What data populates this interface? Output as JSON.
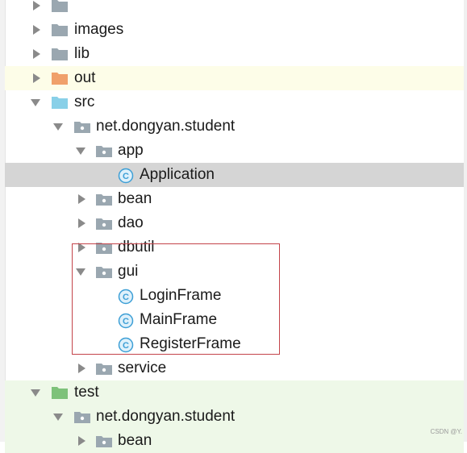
{
  "tree": {
    "rows": [
      {
        "label": "",
        "icon": "folder-icon",
        "arrow": "collapsed",
        "level": 0,
        "cut": true
      },
      {
        "label": "images",
        "icon": "folder-icon",
        "arrow": "collapsed",
        "level": 0
      },
      {
        "label": "lib",
        "icon": "folder-icon",
        "arrow": "collapsed",
        "level": 0
      },
      {
        "label": "out",
        "icon": "excluded-folder-icon",
        "arrow": "collapsed",
        "level": 0,
        "highlight": "yellow"
      },
      {
        "label": "src",
        "icon": "source-folder-icon",
        "arrow": "expanded",
        "level": 0
      },
      {
        "label": "net.dongyan.student",
        "icon": "package-icon",
        "arrow": "expanded",
        "level": 1
      },
      {
        "label": "app",
        "icon": "package-icon",
        "arrow": "expanded",
        "level": 2
      },
      {
        "label": "Application",
        "icon": "class-icon",
        "arrow": "none",
        "level": 3,
        "selected": true
      },
      {
        "label": "bean",
        "icon": "package-icon",
        "arrow": "collapsed",
        "level": 2
      },
      {
        "label": "dao",
        "icon": "package-icon",
        "arrow": "collapsed",
        "level": 2
      },
      {
        "label": "dbutil",
        "icon": "package-icon",
        "arrow": "collapsed",
        "level": 2
      },
      {
        "label": "gui",
        "icon": "package-icon",
        "arrow": "expanded",
        "level": 2
      },
      {
        "label": "LoginFrame",
        "icon": "class-icon",
        "arrow": "none",
        "level": 3
      },
      {
        "label": "MainFrame",
        "icon": "class-icon",
        "arrow": "none",
        "level": 3
      },
      {
        "label": "RegisterFrame",
        "icon": "class-icon",
        "arrow": "none",
        "level": 3
      },
      {
        "label": "service",
        "icon": "package-icon",
        "arrow": "collapsed",
        "level": 2
      },
      {
        "label": "test",
        "icon": "test-folder-icon",
        "arrow": "expanded",
        "level": 0,
        "highlight": "green"
      },
      {
        "label": "net.dongyan.student",
        "icon": "package-icon",
        "arrow": "expanded",
        "level": 1,
        "highlight": "green"
      },
      {
        "label": "bean",
        "icon": "package-icon",
        "arrow": "collapsed",
        "level": 2,
        "highlight": "green"
      }
    ]
  },
  "class_badge_letter": "C",
  "watermark": "CSDN @Y.",
  "colors": {
    "folder": "#9aa7b0",
    "excluded_folder": "#f0a06a",
    "source_folder": "#89d0e8",
    "test_folder": "#7ec27a",
    "package": "#9aa7b0",
    "class_badge": "#3d9fd6",
    "callout_box": "#c4444a"
  }
}
